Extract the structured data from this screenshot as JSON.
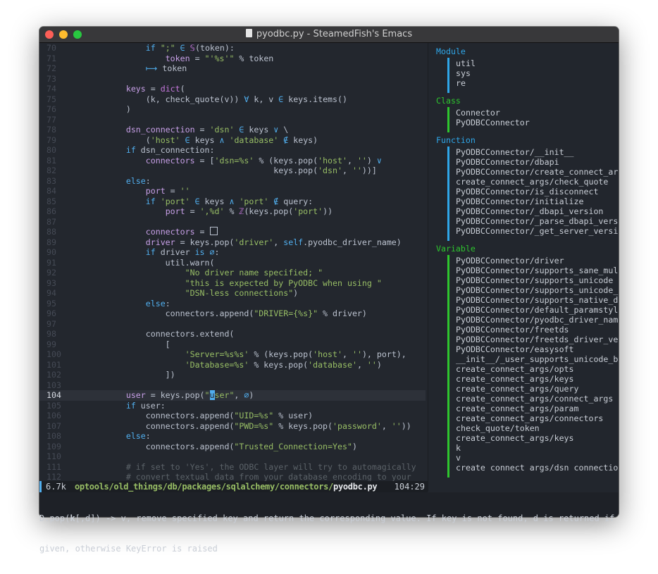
{
  "window": {
    "title": "pyodbc.py - SteamedFish's Emacs",
    "traffic_lights": {
      "close": "#fe5f57",
      "minimize": "#febc2e",
      "zoom": "#28c840"
    }
  },
  "code": {
    "current_line": 104,
    "lines": [
      {
        "n": "70",
        "segs": [
          [
            "p",
            "            "
          ],
          [
            "k",
            "if"
          ],
          [
            "p",
            " "
          ],
          [
            "s",
            "\";\""
          ],
          [
            "p",
            " "
          ],
          [
            "o",
            "∈"
          ],
          [
            "p",
            " "
          ],
          [
            "f",
            "𝕊"
          ],
          [
            "p",
            "(token):"
          ]
        ]
      },
      {
        "n": "71",
        "segs": [
          [
            "p",
            "                "
          ],
          [
            "v",
            "token"
          ],
          [
            "p",
            " = "
          ],
          [
            "s",
            "\"'%s'\""
          ],
          [
            "p",
            " % token"
          ]
        ]
      },
      {
        "n": "72",
        "segs": [
          [
            "p",
            "            "
          ],
          [
            "o",
            "⟼"
          ],
          [
            "p",
            " token"
          ]
        ]
      },
      {
        "n": "73",
        "segs": []
      },
      {
        "n": "74",
        "segs": [
          [
            "p",
            "        "
          ],
          [
            "v",
            "keys"
          ],
          [
            "p",
            " = "
          ],
          [
            "f",
            "dict"
          ],
          [
            "p",
            "("
          ]
        ]
      },
      {
        "n": "75",
        "segs": [
          [
            "p",
            "            (k, check_quote(v)) "
          ],
          [
            "o",
            "∀"
          ],
          [
            "p",
            " k, v "
          ],
          [
            "o",
            "∈"
          ],
          [
            "p",
            " keys.items()"
          ]
        ]
      },
      {
        "n": "76",
        "segs": [
          [
            "p",
            "        )"
          ]
        ]
      },
      {
        "n": "77",
        "segs": []
      },
      {
        "n": "78",
        "segs": [
          [
            "p",
            "        "
          ],
          [
            "v",
            "dsn_connection"
          ],
          [
            "p",
            " = "
          ],
          [
            "s",
            "'dsn'"
          ],
          [
            "p",
            " "
          ],
          [
            "o",
            "∈"
          ],
          [
            "p",
            " keys "
          ],
          [
            "o",
            "∨"
          ],
          [
            "p",
            " \\"
          ]
        ]
      },
      {
        "n": "79",
        "segs": [
          [
            "p",
            "            ("
          ],
          [
            "s",
            "'host'"
          ],
          [
            "p",
            " "
          ],
          [
            "o",
            "∈"
          ],
          [
            "p",
            " keys "
          ],
          [
            "o",
            "∧"
          ],
          [
            "p",
            " "
          ],
          [
            "s",
            "'database'"
          ],
          [
            "p",
            " "
          ],
          [
            "o",
            "∉"
          ],
          [
            "p",
            " keys)"
          ]
        ]
      },
      {
        "n": "80",
        "segs": [
          [
            "p",
            "        "
          ],
          [
            "k",
            "if"
          ],
          [
            "p",
            " dsn_connection:"
          ]
        ]
      },
      {
        "n": "81",
        "segs": [
          [
            "p",
            "            "
          ],
          [
            "v",
            "connectors"
          ],
          [
            "p",
            " = ["
          ],
          [
            "s",
            "'dsn=%s'"
          ],
          [
            "p",
            " % (keys.pop("
          ],
          [
            "s",
            "'host'"
          ],
          [
            "p",
            ", "
          ],
          [
            "s",
            "''"
          ],
          [
            "p",
            ") "
          ],
          [
            "o",
            "∨"
          ]
        ]
      },
      {
        "n": "82",
        "segs": [
          [
            "p",
            "                                      keys.pop("
          ],
          [
            "s",
            "'dsn'"
          ],
          [
            "p",
            ", "
          ],
          [
            "s",
            "''"
          ],
          [
            "p",
            "))]"
          ]
        ]
      },
      {
        "n": "83",
        "segs": [
          [
            "p",
            "        "
          ],
          [
            "k",
            "else"
          ],
          [
            "p",
            ":"
          ]
        ]
      },
      {
        "n": "84",
        "segs": [
          [
            "p",
            "            "
          ],
          [
            "v",
            "port"
          ],
          [
            "p",
            " = "
          ],
          [
            "s",
            "''"
          ]
        ]
      },
      {
        "n": "85",
        "segs": [
          [
            "p",
            "            "
          ],
          [
            "k",
            "if"
          ],
          [
            "p",
            " "
          ],
          [
            "s",
            "'port'"
          ],
          [
            "p",
            " "
          ],
          [
            "o",
            "∈"
          ],
          [
            "p",
            " keys "
          ],
          [
            "o",
            "∧"
          ],
          [
            "p",
            " "
          ],
          [
            "s",
            "'port'"
          ],
          [
            "p",
            " "
          ],
          [
            "o",
            "∉"
          ],
          [
            "p",
            " query:"
          ]
        ]
      },
      {
        "n": "86",
        "segs": [
          [
            "p",
            "                "
          ],
          [
            "v",
            "port"
          ],
          [
            "p",
            " = "
          ],
          [
            "s",
            "',%d'"
          ],
          [
            "p",
            " % "
          ],
          [
            "f",
            "ℤ"
          ],
          [
            "p",
            "(keys.pop("
          ],
          [
            "s",
            "'port'"
          ],
          [
            "p",
            "))"
          ]
        ]
      },
      {
        "n": "87",
        "segs": []
      },
      {
        "n": "88",
        "segs": [
          [
            "p",
            "            "
          ],
          [
            "v",
            "connectors"
          ],
          [
            "p",
            " = "
          ],
          [
            "box",
            ""
          ]
        ]
      },
      {
        "n": "89",
        "segs": [
          [
            "p",
            "            "
          ],
          [
            "v",
            "driver"
          ],
          [
            "p",
            " = keys.pop("
          ],
          [
            "s",
            "'driver'"
          ],
          [
            "p",
            ", "
          ],
          [
            "k",
            "self"
          ],
          [
            "p",
            ".pyodbc_driver_name)"
          ]
        ]
      },
      {
        "n": "90",
        "segs": [
          [
            "p",
            "            "
          ],
          [
            "k",
            "if"
          ],
          [
            "p",
            " driver "
          ],
          [
            "k",
            "is"
          ],
          [
            "p",
            " "
          ],
          [
            "o",
            "∅"
          ],
          [
            "p",
            ":"
          ]
        ]
      },
      {
        "n": "91",
        "segs": [
          [
            "p",
            "                util.warn("
          ]
        ]
      },
      {
        "n": "92",
        "segs": [
          [
            "p",
            "                    "
          ],
          [
            "s",
            "\"No driver name specified; \""
          ]
        ]
      },
      {
        "n": "93",
        "segs": [
          [
            "p",
            "                    "
          ],
          [
            "s",
            "\"this is expected by PyODBC when using \""
          ]
        ]
      },
      {
        "n": "94",
        "segs": [
          [
            "p",
            "                    "
          ],
          [
            "s",
            "\"DSN-less connections\""
          ],
          [
            "p",
            ")"
          ]
        ]
      },
      {
        "n": "95",
        "segs": [
          [
            "p",
            "            "
          ],
          [
            "k",
            "else"
          ],
          [
            "p",
            ":"
          ]
        ]
      },
      {
        "n": "96",
        "segs": [
          [
            "p",
            "                connectors.append("
          ],
          [
            "s",
            "\"DRIVER={%s}\""
          ],
          [
            "p",
            " % driver)"
          ]
        ]
      },
      {
        "n": "97",
        "segs": []
      },
      {
        "n": "98",
        "segs": [
          [
            "p",
            "            connectors.extend("
          ]
        ]
      },
      {
        "n": "99",
        "segs": [
          [
            "p",
            "                ["
          ]
        ]
      },
      {
        "n": "100",
        "segs": [
          [
            "p",
            "                    "
          ],
          [
            "s",
            "'Server=%s%s'"
          ],
          [
            "p",
            " % (keys.pop("
          ],
          [
            "s",
            "'host'"
          ],
          [
            "p",
            ", "
          ],
          [
            "s",
            "''"
          ],
          [
            "p",
            "), port),"
          ]
        ]
      },
      {
        "n": "101",
        "segs": [
          [
            "p",
            "                    "
          ],
          [
            "s",
            "'Database=%s'"
          ],
          [
            "p",
            " % keys.pop("
          ],
          [
            "s",
            "'database'"
          ],
          [
            "p",
            ", "
          ],
          [
            "s",
            "''"
          ],
          [
            "p",
            ")"
          ]
        ]
      },
      {
        "n": "102",
        "segs": [
          [
            "p",
            "                ])"
          ]
        ]
      },
      {
        "n": "103",
        "segs": []
      },
      {
        "n": "104",
        "segs": [
          [
            "p",
            "        "
          ],
          [
            "v",
            "user"
          ],
          [
            "p",
            " = keys.pop("
          ],
          [
            "s",
            "\""
          ],
          [
            "cursor",
            "u"
          ],
          [
            "s",
            "ser\""
          ],
          [
            "p",
            ", "
          ],
          [
            "o",
            "∅"
          ],
          [
            "p",
            ")"
          ]
        ]
      },
      {
        "n": "105",
        "segs": [
          [
            "p",
            "        "
          ],
          [
            "k",
            "if"
          ],
          [
            "p",
            " user:"
          ]
        ]
      },
      {
        "n": "106",
        "segs": [
          [
            "p",
            "            connectors.append("
          ],
          [
            "s",
            "\"UID=%s\""
          ],
          [
            "p",
            " % user)"
          ]
        ]
      },
      {
        "n": "107",
        "segs": [
          [
            "p",
            "            connectors.append("
          ],
          [
            "s",
            "\"PWD=%s\""
          ],
          [
            "p",
            " % keys.pop("
          ],
          [
            "s",
            "'password'"
          ],
          [
            "p",
            ", "
          ],
          [
            "s",
            "''"
          ],
          [
            "p",
            "))"
          ]
        ]
      },
      {
        "n": "108",
        "segs": [
          [
            "p",
            "        "
          ],
          [
            "k",
            "else"
          ],
          [
            "p",
            ":"
          ]
        ]
      },
      {
        "n": "109",
        "segs": [
          [
            "p",
            "            connectors.append("
          ],
          [
            "s",
            "\"Trusted_Connection=Yes\""
          ],
          [
            "p",
            ")"
          ]
        ]
      },
      {
        "n": "110",
        "segs": []
      },
      {
        "n": "111",
        "segs": [
          [
            "p",
            "        "
          ],
          [
            "c",
            "# if set to 'Yes', the ODBC layer will try to automagically"
          ]
        ]
      },
      {
        "n": "112",
        "segs": [
          [
            "p",
            "        "
          ],
          [
            "c",
            "# convert textual data from your database encoding to your"
          ]
        ]
      }
    ]
  },
  "sidebar": {
    "groups": [
      {
        "title": "Module",
        "color": "#2fa6e8",
        "items": [
          "util",
          "sys",
          "re"
        ]
      },
      {
        "title": "Class",
        "color": "#2ec52e",
        "items": [
          "Connector",
          "PyODBCConnector"
        ]
      },
      {
        "title": "Function",
        "color": "#2fa6e8",
        "items": [
          "PyODBCConnector/__init__",
          "PyODBCConnector/dbapi",
          "PyODBCConnector/create_connect_ar",
          "create_connect_args/check_quote",
          "PyODBCConnector/is_disconnect",
          "PyODBCConnector/initialize",
          "PyODBCConnector/_dbapi_version",
          "PyODBCConnector/_parse_dbapi_vers",
          "PyODBCConnector/_get_server_versi"
        ]
      },
      {
        "title": "Variable",
        "color": "#2ec52e",
        "items": [
          "PyODBCConnector/driver",
          "PyODBCConnector/supports_sane_mul",
          "PyODBCConnector/supports_unicode",
          "PyODBCConnector/supports_unicode_",
          "PyODBCConnector/supports_native_d",
          "PyODBCConnector/default_paramstyl",
          "PyODBCConnector/pyodbc_driver_nam",
          "PyODBCConnector/freetds",
          "PyODBCConnector/freetds_driver_ve",
          "PyODBCConnector/easysoft",
          "__init__/_user_supports_unicode_b",
          "create_connect_args/opts",
          "create_connect_args/keys",
          "create_connect_args/query",
          "create_connect_args/connect_args",
          "create_connect_args/param",
          "create_connect_args/connectors",
          "check_quote/token",
          "create_connect_args/keys",
          "k",
          "v",
          "create connect args/dsn connectio"
        ]
      }
    ]
  },
  "modeline": {
    "size": "6.7k",
    "dir": "optools/old_things/db/packages/sqlalchemy/connectors/",
    "file": "pyodbc.py",
    "position": "104:29"
  },
  "echo": {
    "line1_prefix": "D.pop(",
    "line1_bold": "k",
    "line1_rest": "[,d]) -> v, remove specified key and return the corresponding value. If key is not found, d is returned if",
    "line2": "given, otherwise KeyError is raised"
  }
}
